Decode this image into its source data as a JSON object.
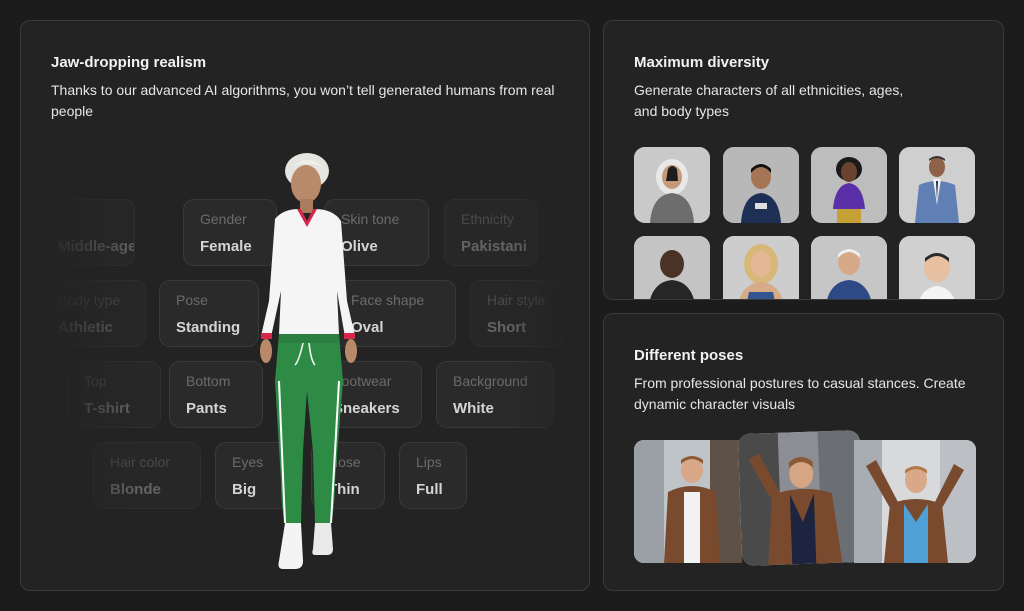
{
  "realism": {
    "title": "Jaw-dropping realism",
    "description": "Thanks to our advanced AI algorithms, you won’t tell generated humans from real people",
    "attributes": [
      {
        "label": "",
        "value": "Middle-aged",
        "dim": true
      },
      {
        "label": "Gender",
        "value": "Female",
        "dim": false
      },
      {
        "label": "Skin tone",
        "value": "Olive",
        "dim": false
      },
      {
        "label": "Ethnicity",
        "value": "Pakistani",
        "dim": true
      },
      {
        "label": "Body type",
        "value": "Athletic",
        "dim": true
      },
      {
        "label": "Pose",
        "value": "Standing",
        "dim": false
      },
      {
        "label": "Face shape",
        "value": "Oval",
        "dim": false
      },
      {
        "label": "Hair style",
        "value": "Short",
        "dim": true
      },
      {
        "label": "Top",
        "value": "T-shirt",
        "dim": true
      },
      {
        "label": "Bottom",
        "value": "Pants",
        "dim": false
      },
      {
        "label": "Footwear",
        "value": "Sneakers",
        "dim": false
      },
      {
        "label": "Background",
        "value": "White",
        "dim": false
      },
      {
        "label": "Hair color",
        "value": "Blonde",
        "dim": true
      },
      {
        "label": "Eyes",
        "value": "Big",
        "dim": false
      },
      {
        "label": "Nose",
        "value": "Thin",
        "dim": false
      },
      {
        "label": "Lips",
        "value": "Full",
        "dim": false
      }
    ]
  },
  "diversity": {
    "title": "Maximum diversity",
    "description": "Generate characters of all ethnicities, ages, and body types"
  },
  "poses": {
    "title": "Different poses",
    "description": "From professional postures to casual stances. Create dynamic character visuals"
  },
  "colors": {
    "background": "#1c1c1c",
    "card": "#232323",
    "card_border": "#3a3a3a",
    "jacket_brown": "#7a4a2e",
    "pants_green": "#2e8b46",
    "collar_red": "#d6284a"
  }
}
